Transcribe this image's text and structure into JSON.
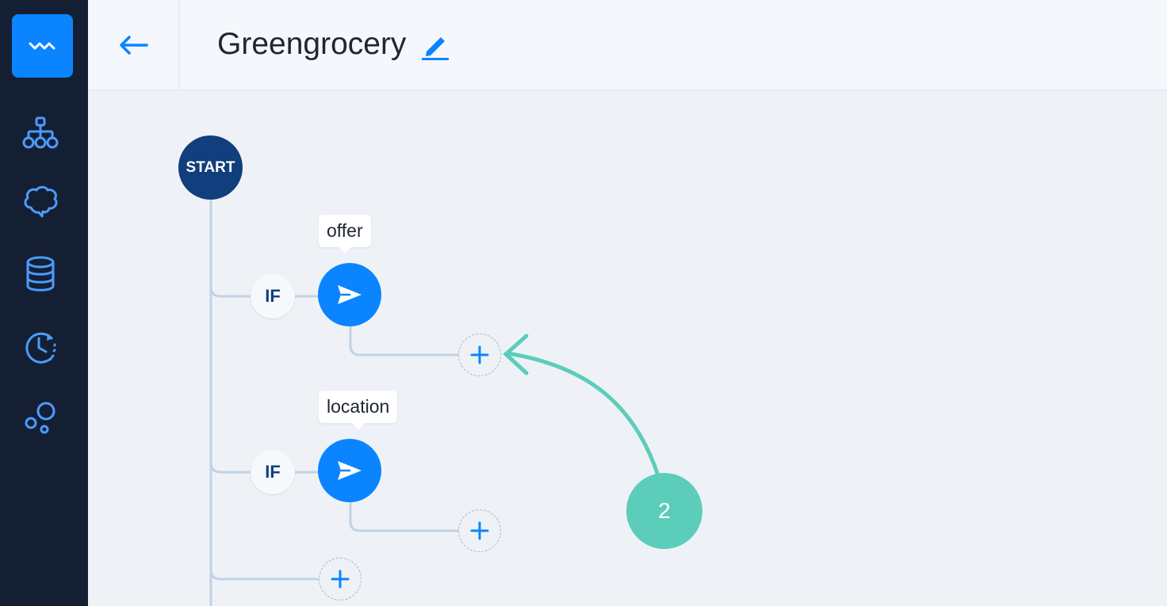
{
  "header": {
    "title": "Greengrocery",
    "back_icon": "arrow-left-icon",
    "edit_icon": "pencil-icon"
  },
  "sidebar": {
    "logo_icon": "wave-logo-icon",
    "items": [
      {
        "icon": "sitemap-icon"
      },
      {
        "icon": "brain-icon"
      },
      {
        "icon": "database-icon"
      },
      {
        "icon": "history-clock-icon"
      },
      {
        "icon": "bubbles-icon"
      }
    ]
  },
  "flow": {
    "start_label": "START",
    "branches": [
      {
        "condition": "IF",
        "action_tooltip": "offer",
        "action_icon": "send-icon"
      },
      {
        "condition": "IF",
        "action_tooltip": "location",
        "action_icon": "send-icon"
      }
    ],
    "add_icon": "plus-icon"
  },
  "annotation": {
    "step": "2"
  },
  "colors": {
    "sidebar_bg": "#151f33",
    "accent": "#0a84ff",
    "start_node": "#113e7c",
    "annotation": "#5ccdbb",
    "connector": "#c3d2e3"
  }
}
